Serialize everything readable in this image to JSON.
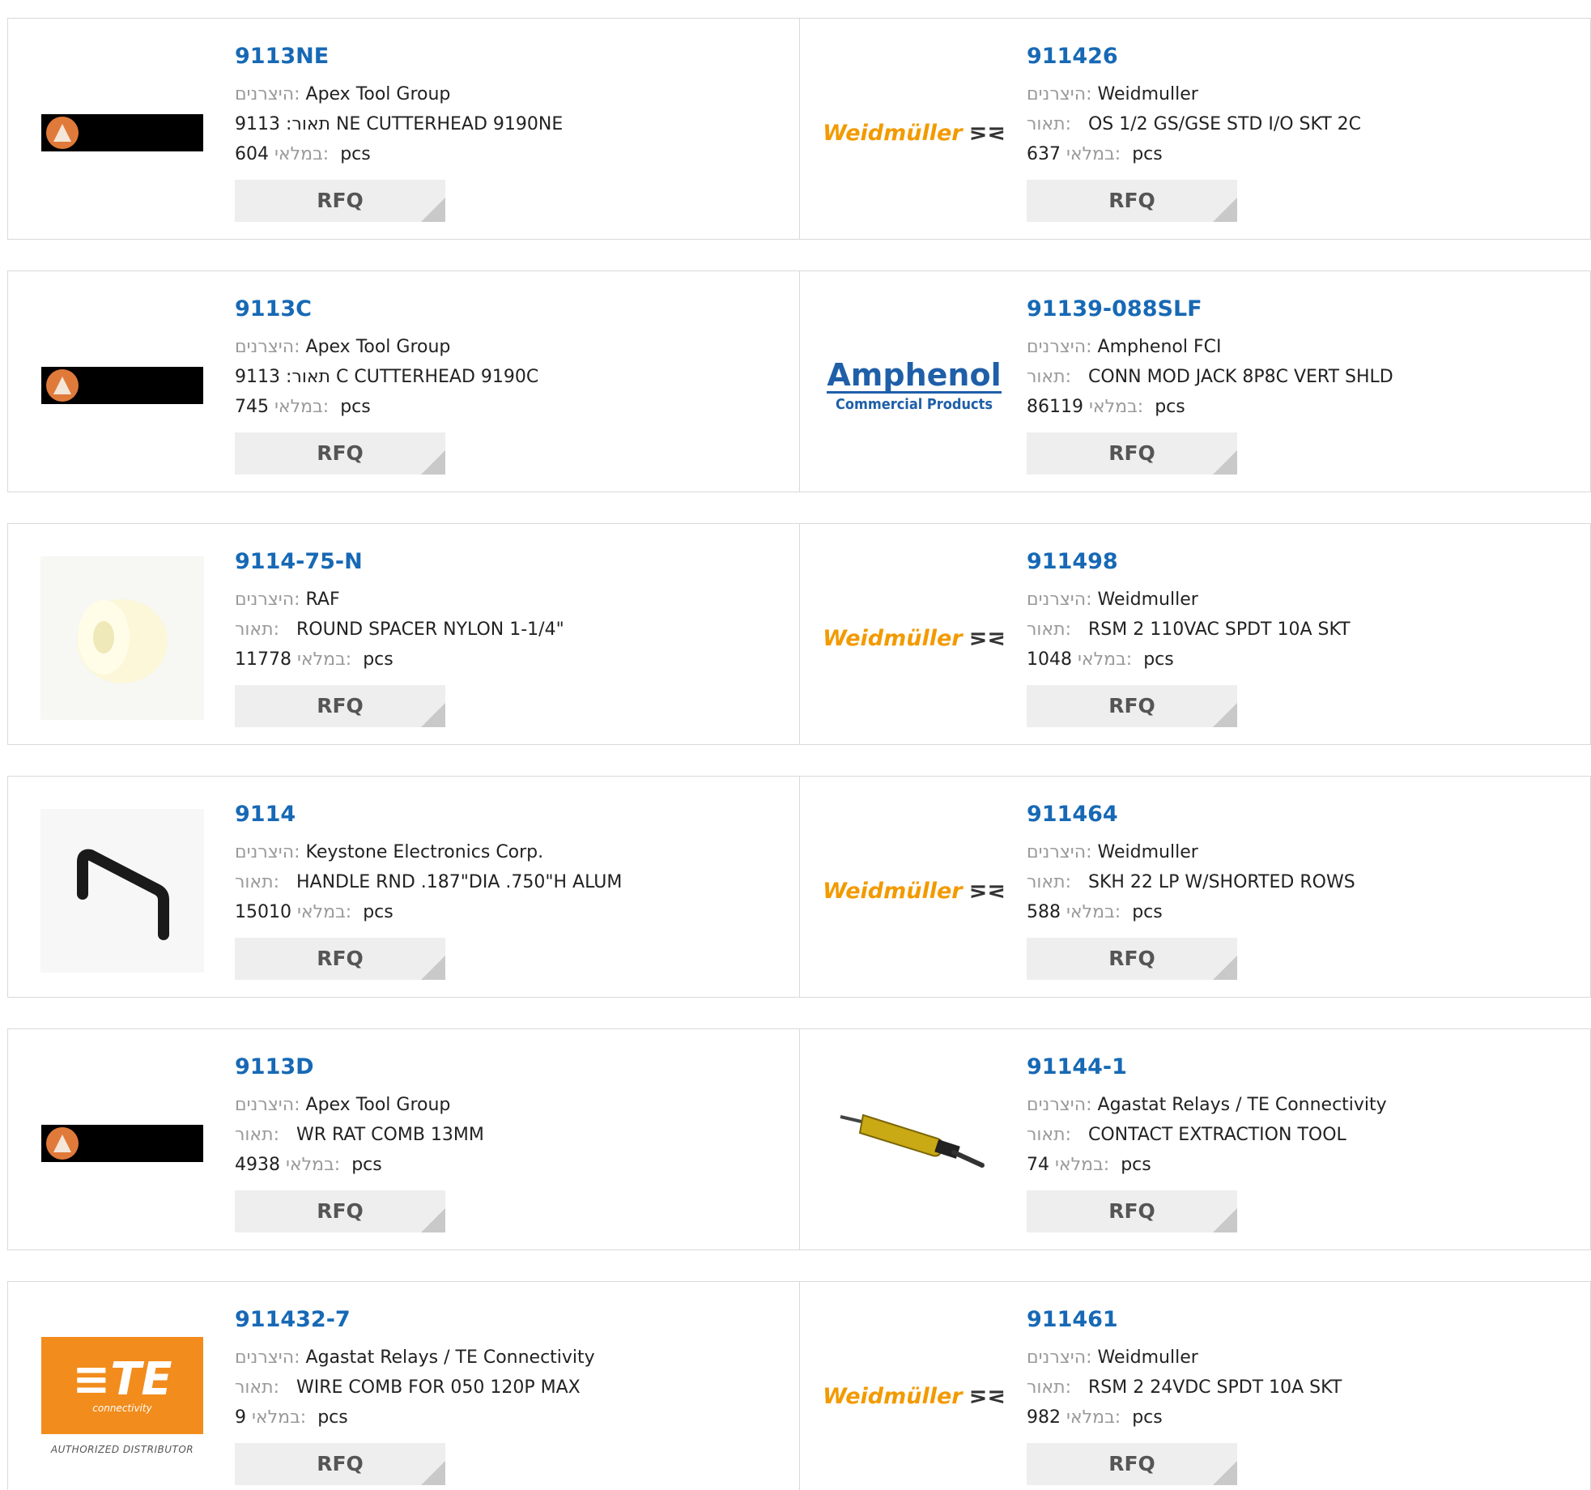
{
  "labels": {
    "manufacturer": "היצרנים:",
    "description": "תאור:",
    "stock": "במלאי:",
    "unit": "pcs",
    "rfq": "RFQ"
  },
  "rows": [
    {
      "left": {
        "pn": "9113NE",
        "mfr": "Apex Tool Group",
        "desc": "9113 :תאור NE CUTTERHEAD 9190NE",
        "qty": "604",
        "logo": "apex-logo"
      },
      "right": {
        "pn": "911426",
        "mfr": "Weidmuller",
        "desc": "OS 1/2 GS/GSE STD I/O SKT 2C",
        "qty": "637",
        "logo": "weidmuller-logo"
      }
    },
    {
      "left": {
        "pn": "9113C",
        "mfr": "Apex Tool Group",
        "desc": "9113 :תאור C CUTTERHEAD 9190C",
        "qty": "745",
        "logo": "apex-logo"
      },
      "right": {
        "pn": "91139-088SLF",
        "mfr": "Amphenol FCI",
        "desc": "CONN MOD JACK 8P8C VERT SHLD",
        "qty": "86119",
        "logo": "amphenol-logo"
      }
    },
    {
      "left": {
        "pn": "9114-75-N",
        "mfr": "RAF",
        "desc": "ROUND SPACER NYLON 1-1/4\"",
        "qty": "11778",
        "logo": "spacer-photo"
      },
      "right": {
        "pn": "911498",
        "mfr": "Weidmuller",
        "desc": "RSM 2 110VAC SPDT 10A SKT",
        "qty": "1048",
        "logo": "weidmuller-logo"
      }
    },
    {
      "left": {
        "pn": "9114",
        "mfr": "Keystone Electronics Corp.",
        "desc": "HANDLE RND .187\"DIA .750\"H ALUM",
        "qty": "15010",
        "logo": "handle-photo"
      },
      "right": {
        "pn": "911464",
        "mfr": "Weidmuller",
        "desc": "SKH 22 LP W/SHORTED ROWS",
        "qty": "588",
        "logo": "weidmuller-logo"
      }
    },
    {
      "left": {
        "pn": "9113D",
        "mfr": "Apex Tool Group",
        "desc": "WR RAT COMB 13MM",
        "qty": "4938",
        "logo": "apex-logo"
      },
      "right": {
        "pn": "91144-1",
        "mfr": "Agastat Relays / TE Connectivity",
        "desc": "CONTACT EXTRACTION TOOL",
        "qty": "74",
        "logo": "tool-photo"
      }
    },
    {
      "left": {
        "pn": "911432-7",
        "mfr": "Agastat Relays / TE Connectivity",
        "desc": "WIRE COMB FOR 050 120P MAX",
        "qty": "9",
        "logo": "te-logo"
      },
      "right": {
        "pn": "911461",
        "mfr": "Weidmuller",
        "desc": "RSM 2 24VDC SPDT 10A SKT",
        "qty": "982",
        "logo": "weidmuller-logo"
      }
    }
  ],
  "logo_text": {
    "weidmuller": "Weidmüller",
    "weidmuller_symbol": "⋝⋜",
    "amphenol": "Amphenol",
    "amphenol_sub": "Commercial Products",
    "te": "≡TE",
    "te_sub": "connectivity",
    "te_auth": "AUTHORIZED DISTRIBUTOR"
  },
  "colors": {
    "part_number": "#1769b5",
    "weidmuller": "#f29a00",
    "amphenol": "#1f5fa8",
    "te": "#f28c1c"
  }
}
